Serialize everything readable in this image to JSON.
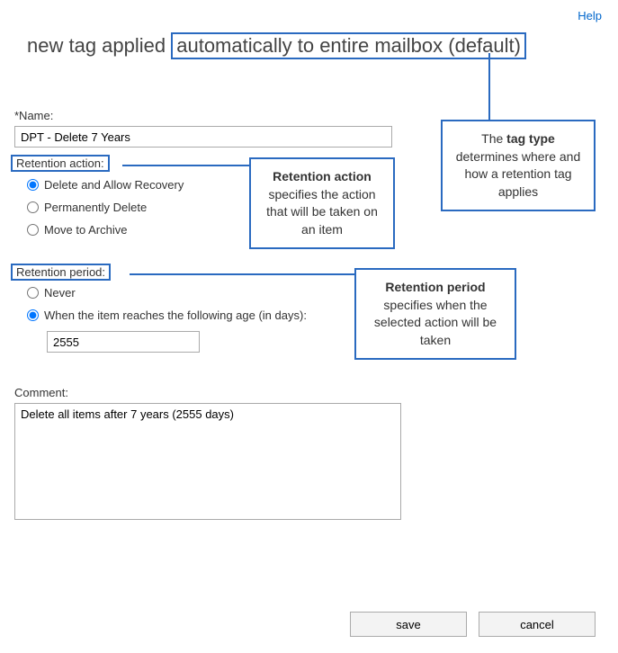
{
  "help_link": "Help",
  "title": {
    "prefix": "new tag applied ",
    "tag_type": "automatically to entire mailbox (default)"
  },
  "name": {
    "label": "*Name:",
    "value": "DPT - Delete 7 Years"
  },
  "retention_action": {
    "label": "Retention action:",
    "options": {
      "delete_allow": "Delete and Allow Recovery",
      "permanent": "Permanently Delete",
      "archive": "Move to Archive"
    },
    "selected": "delete_allow"
  },
  "retention_period": {
    "label": "Retention period:",
    "options": {
      "never": "Never",
      "age": "When the item reaches the following age (in days):"
    },
    "selected": "age",
    "days": "2555"
  },
  "comment": {
    "label": "Comment:",
    "value": "Delete all items after 7 years (2555 days)"
  },
  "callouts": {
    "tag_type": "The <b>tag type</b> determines where and how a retention tag applies",
    "action": "<b>Retention action</b> specifies the action that will be taken on an item",
    "period": "<b>Retention period</b> specifies when the selected action will be taken"
  },
  "buttons": {
    "save": "save",
    "cancel": "cancel"
  }
}
